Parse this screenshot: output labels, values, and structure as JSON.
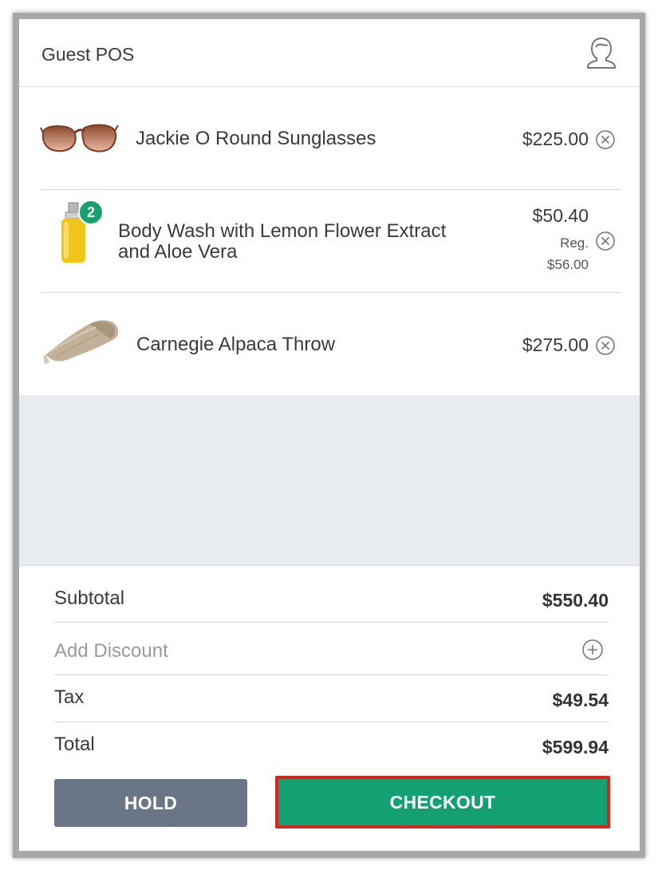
{
  "header": {
    "title": "Guest POS",
    "customer_icon": "customer-profile-icon"
  },
  "cart": {
    "items": [
      {
        "name": "Jackie O Round Sunglasses",
        "price": "$225.00",
        "image": "sunglasses-thumbnail",
        "quantity_badge": null
      },
      {
        "name_line1": "Body Wash with Lemon Flower Extract",
        "name_line2": "and Aloe Vera",
        "price": "$50.40",
        "reg_label": "Reg.",
        "reg_price": "$56.00",
        "image": "body-wash-bottle-thumbnail",
        "quantity_badge": "2"
      },
      {
        "name": "Carnegie Alpaca Throw",
        "price": "$275.00",
        "image": "alpaca-throw-thumbnail",
        "quantity_badge": null
      }
    ],
    "remove_icon": "remove-circle-x-icon"
  },
  "summary": {
    "subtotal_label": "Subtotal",
    "subtotal_value": "$550.40",
    "discount_label": "Add Discount",
    "discount_icon": "plus-circle-icon",
    "tax_label": "Tax",
    "tax_value": "$49.54",
    "total_label": "Total",
    "total_value": "$599.94"
  },
  "actions": {
    "hold_label": "HOLD",
    "checkout_label": "CHECKOUT"
  },
  "colors": {
    "accent_green": "#14a073",
    "hold_gray": "#6a7585",
    "highlight_red": "#d9261c",
    "empty_area": "#e8ebef"
  }
}
